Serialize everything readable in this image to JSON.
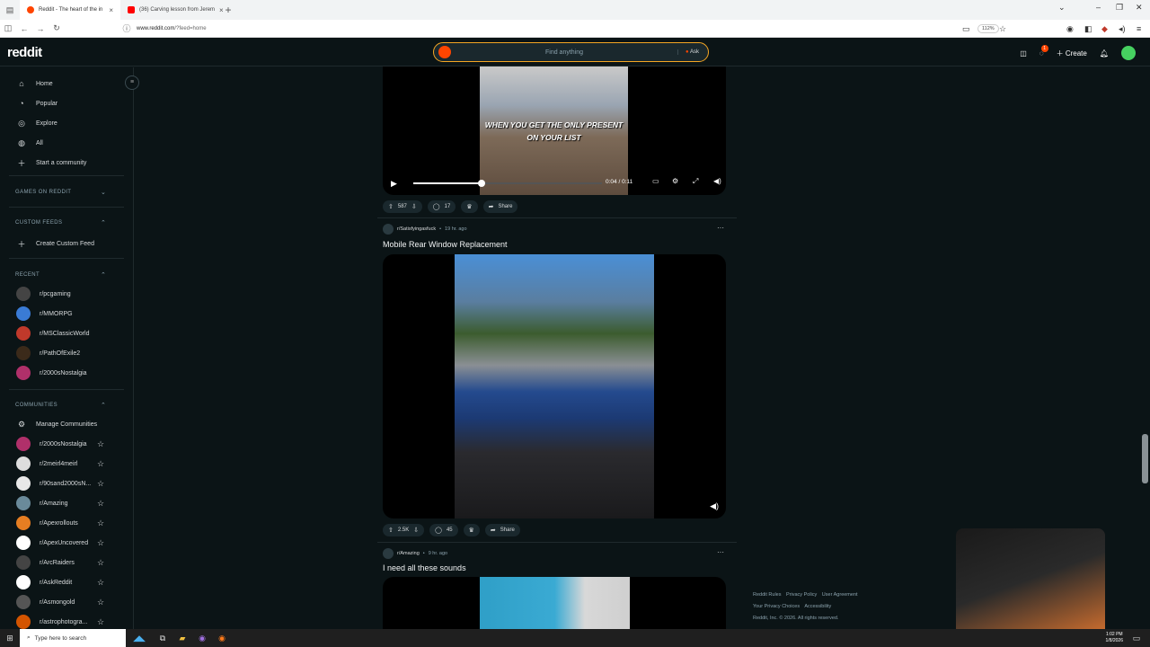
{
  "browser": {
    "tabs": [
      {
        "label": "Reddit - The heart of the in"
      },
      {
        "label": "(36) Carving lesson from Jerem"
      }
    ],
    "url_host": "www.reddit.com",
    "url_path": "/?feed=home",
    "zoom": "112%"
  },
  "header": {
    "logo": "reddit",
    "search_placeholder": "Find anything",
    "ask_label": "Ask",
    "create_label": "Create"
  },
  "sidebar": {
    "nav": [
      {
        "label": "Home",
        "icon": "home-icon"
      },
      {
        "label": "Popular",
        "icon": "popular-icon"
      },
      {
        "label": "Explore",
        "icon": "explore-icon"
      },
      {
        "label": "All",
        "icon": "all-icon"
      },
      {
        "label": "Start a community",
        "icon": "plus-icon"
      }
    ],
    "games_section": "GAMES ON REDDIT",
    "custom_feeds_section": "CUSTOM FEEDS",
    "create_custom_feed": "Create Custom Feed",
    "recent_section": "RECENT",
    "recent": [
      {
        "label": "r/pcgaming",
        "color": "#444444"
      },
      {
        "label": "r/MMORPG",
        "color": "#3a7bd5"
      },
      {
        "label": "r/MSClassicWorld",
        "color": "#c0392b"
      },
      {
        "label": "r/PathOfExile2",
        "color": "#3b2a1a"
      },
      {
        "label": "r/2000sNostalgia",
        "color": "#b0306a"
      }
    ],
    "communities_section": "COMMUNITIES",
    "manage_communities": "Manage Communities",
    "communities": [
      {
        "label": "r/2000sNostalgia",
        "color": "#b0306a"
      },
      {
        "label": "r/2meirl4meirl",
        "color": "#dddddd"
      },
      {
        "label": "r/90sand2000sN...",
        "color": "#e8e8e8"
      },
      {
        "label": "r/Amazing",
        "color": "#6a8a9a"
      },
      {
        "label": "r/Apexrollouts",
        "color": "#e67e22"
      },
      {
        "label": "r/ApexUncovered",
        "color": "#ffffff"
      },
      {
        "label": "r/ArcRaiders",
        "color": "#444444"
      },
      {
        "label": "r/AskReddit",
        "color": "#ffffff"
      },
      {
        "label": "r/Asmongold",
        "color": "#555555"
      },
      {
        "label": "r/astrophotogra...",
        "color": "#d35400"
      }
    ]
  },
  "feed": {
    "post1": {
      "caption_line1": "WHEN YOU GET THE ONLY PRESENT",
      "caption_line2": "ON YOUR LIST",
      "time": "0:04 / 0:11",
      "progress": 0.36,
      "upvotes": "587",
      "comments": "17",
      "share": "Share"
    },
    "post2": {
      "subreddit": "r/Satisfyingasfuck",
      "age": "19 hr. ago",
      "title": "Mobile Rear Window Replacement",
      "upvotes": "2.5K",
      "comments": "45",
      "share": "Share"
    },
    "post3": {
      "subreddit": "r/Amazing",
      "age": "9 hr. ago",
      "title": "I need all these sounds"
    }
  },
  "footer": {
    "links": [
      "Reddit Rules",
      "Privacy Policy",
      "User Agreement",
      "Your Privacy Choices",
      "Accessibility"
    ],
    "copyright": "Reddit, Inc. © 2026. All rights reserved."
  },
  "taskbar": {
    "search_placeholder": "Type here to search",
    "time": "1:02 PM",
    "date": "1/8/2026"
  }
}
